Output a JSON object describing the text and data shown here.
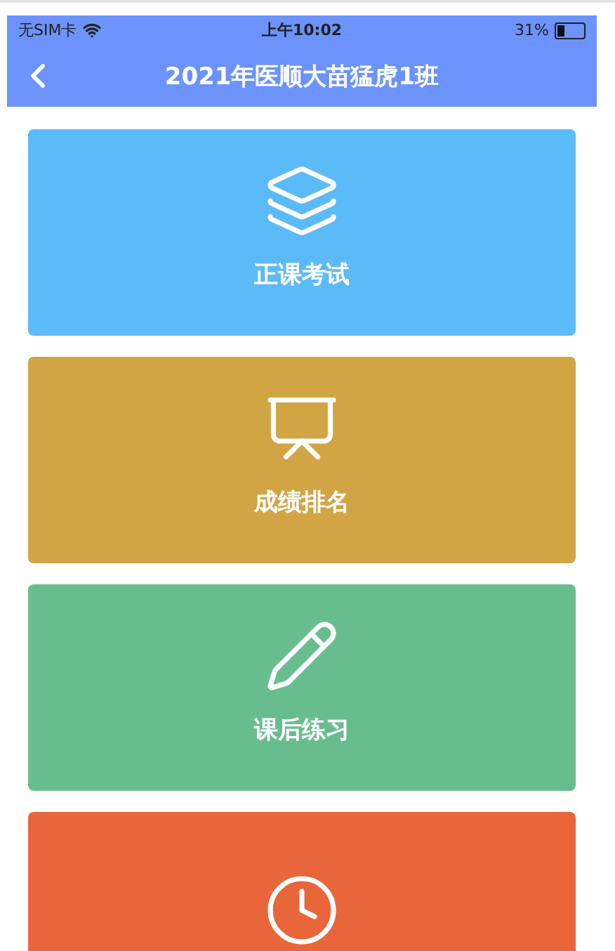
{
  "status_bar": {
    "carrier": "无SIM卡",
    "time": "上午10:02",
    "battery": "31%"
  },
  "nav": {
    "title": "2021年医顺大苗猛虎1班"
  },
  "cards": [
    {
      "kind": "layers",
      "label": "正课考试",
      "color": "#5bbaf8"
    },
    {
      "kind": "board",
      "label": "成绩排名",
      "color": "#d1a543"
    },
    {
      "kind": "pencil",
      "label": "课后练习",
      "color": "#68bd8f"
    },
    {
      "kind": "clock",
      "color": "#e86639"
    }
  ]
}
